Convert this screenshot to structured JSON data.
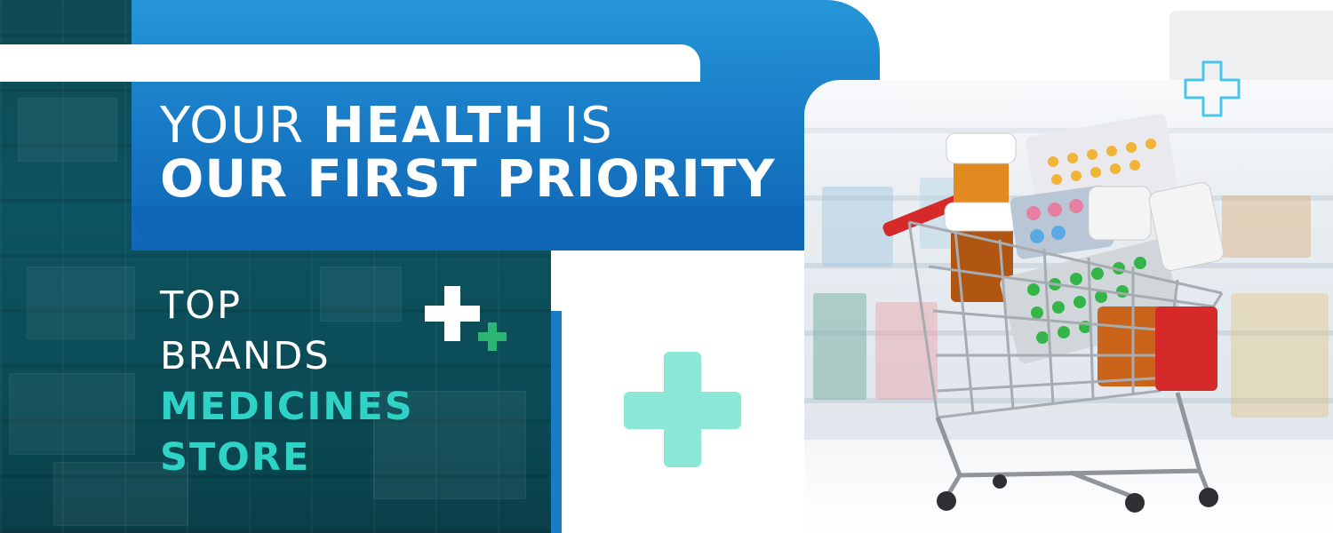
{
  "headline": {
    "line1_prefix": "YOUR ",
    "line1_bold": "HEALTH",
    "line1_suffix": " IS",
    "line2": "OUR FIRST PRIORITY"
  },
  "tagline": {
    "line1": "TOP",
    "line2": "BRANDS",
    "line3": "MEDICINES",
    "line4": "STORE"
  },
  "icons": [
    "plus-icon-white",
    "plus-icon-green",
    "plus-icon-mint",
    "plus-icon-outline",
    "shopping-cart-icon"
  ],
  "colors": {
    "brand_blue": "#1778c4",
    "dark_teal": "#0c5360",
    "accent_teal": "#2ed3c6",
    "mint": "#8be8d6",
    "green": "#2bb673",
    "outline_cyan": "#47c6e8"
  }
}
